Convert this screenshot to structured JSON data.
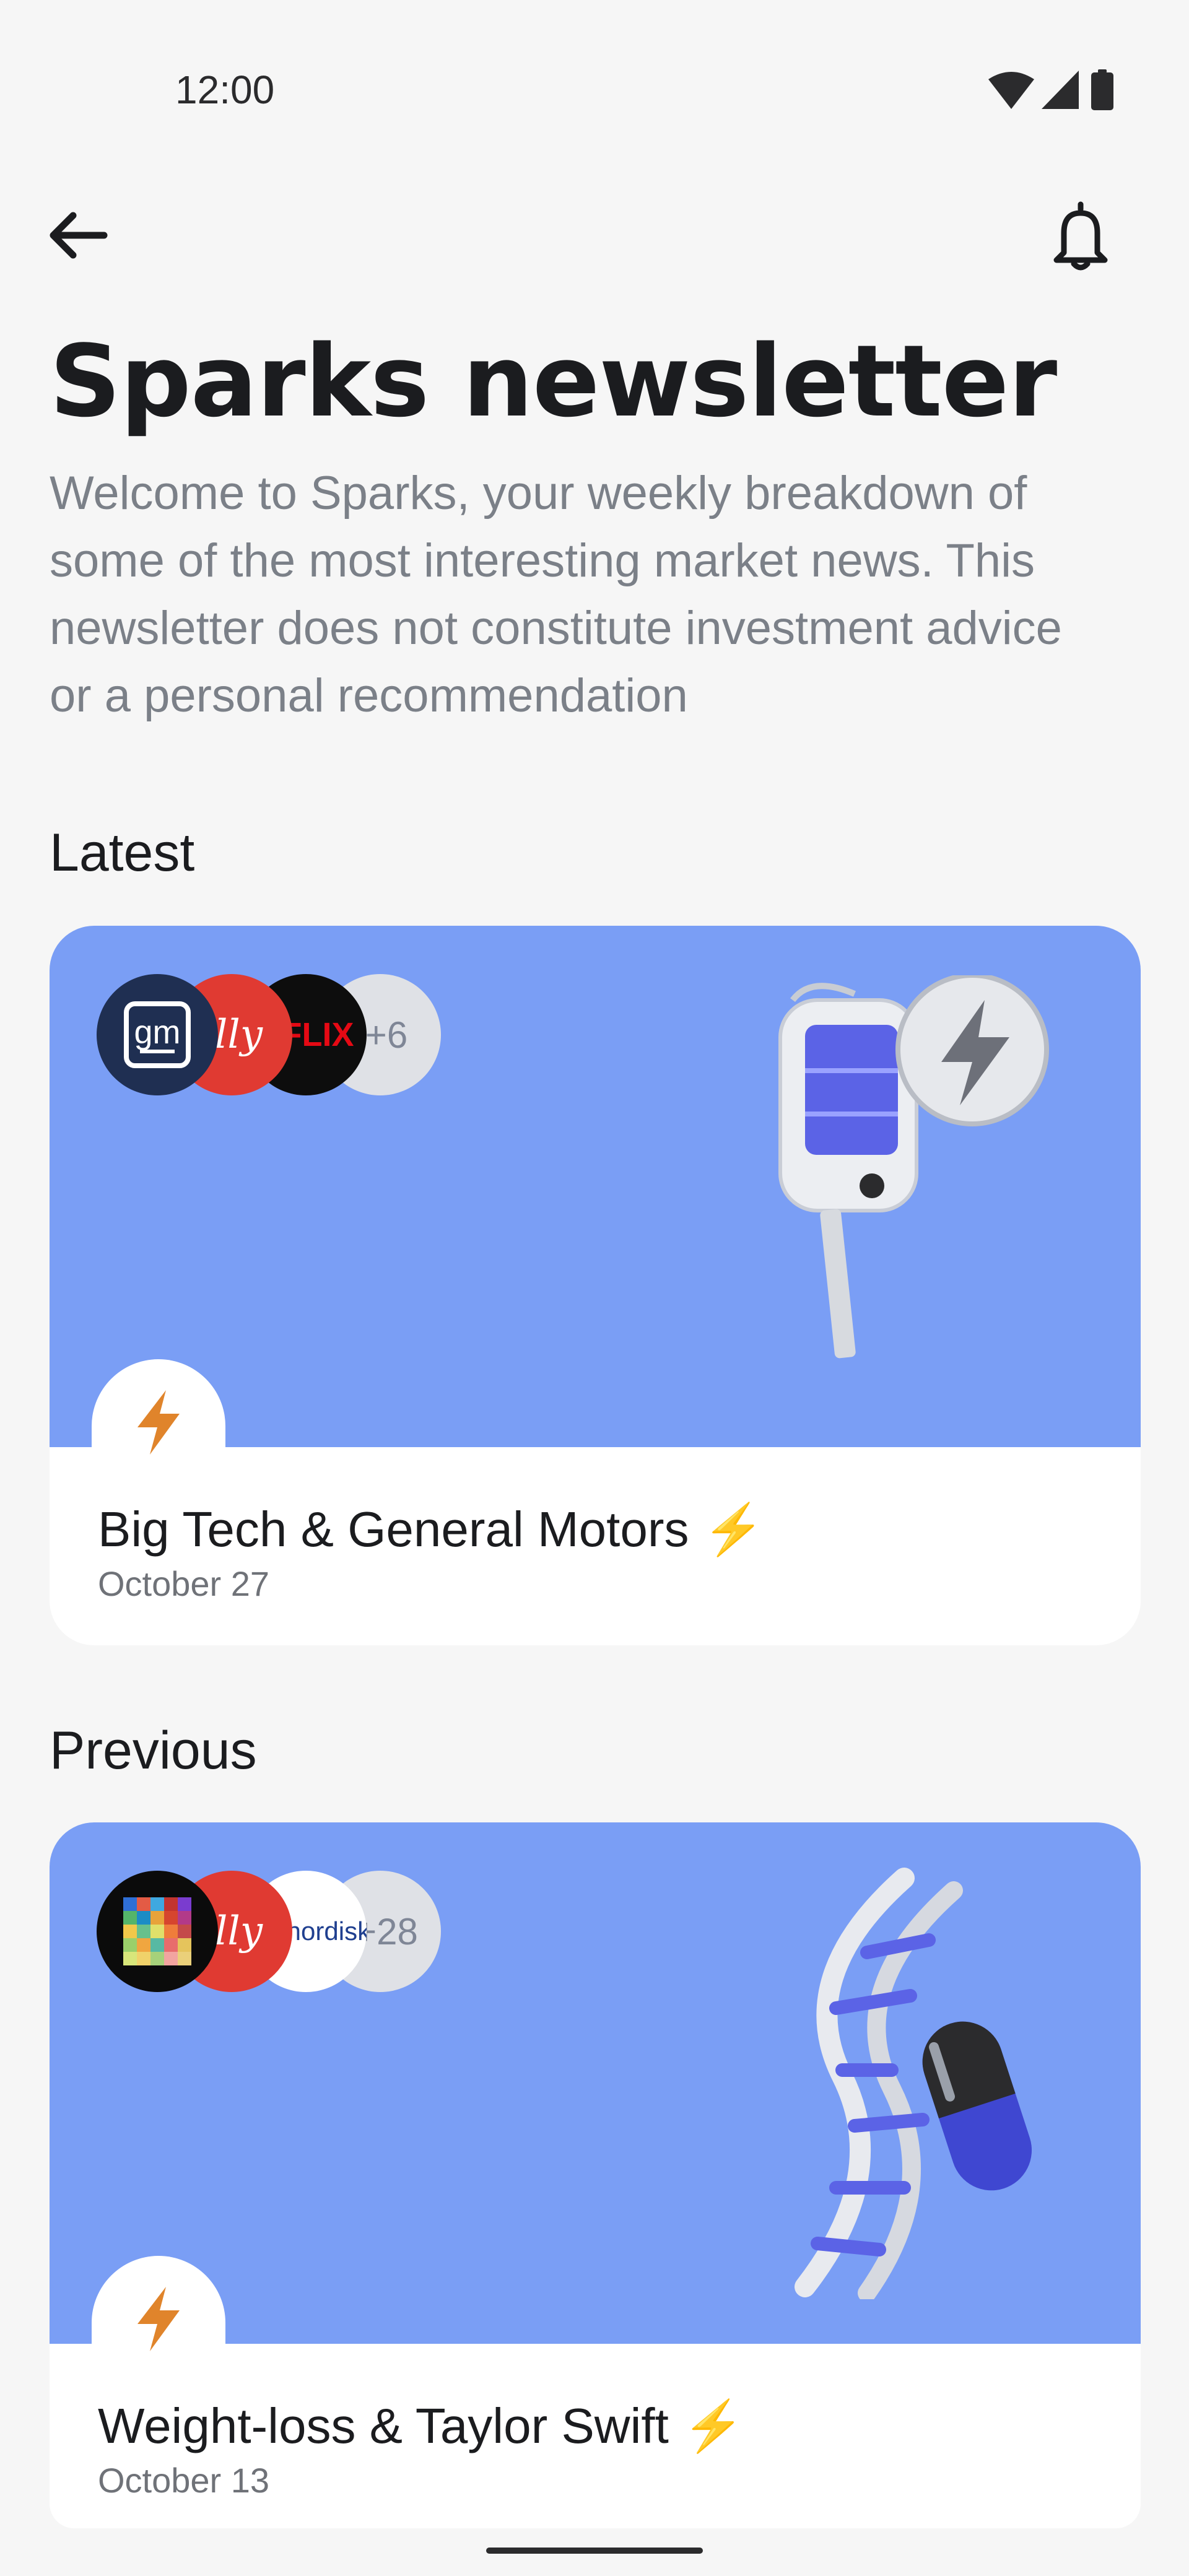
{
  "status_bar": {
    "time": "12:00",
    "icons": [
      "wifi-icon",
      "cellular-signal-icon",
      "battery-icon"
    ]
  },
  "header": {
    "back_icon": "arrow-left-icon",
    "notification_icon": "bell-icon"
  },
  "page": {
    "title": "Sparks newsletter",
    "intro": "Welcome to Sparks, your weekly breakdown of some of the most interesting market news. This newsletter does not constitute investment advice or a personal recommendation"
  },
  "sections": {
    "latest": {
      "title": "Latest",
      "card": {
        "title": "Big Tech & General Motors ⚡",
        "date": "October 27",
        "more_count": "+6",
        "logos": [
          "gm",
          "Lilly",
          "NETFLIX"
        ]
      }
    },
    "previous": {
      "title": "Previous",
      "card": {
        "title": "Weight-loss & Taylor Swift ⚡",
        "date": "October 13",
        "more_count": "+28",
        "logos": [
          "Lilly",
          "novo nordisk"
        ]
      }
    }
  },
  "colors": {
    "card_background": "#7a9ef5",
    "bolt_orange": "#e0842b",
    "page_background": "#f6f6f6"
  }
}
